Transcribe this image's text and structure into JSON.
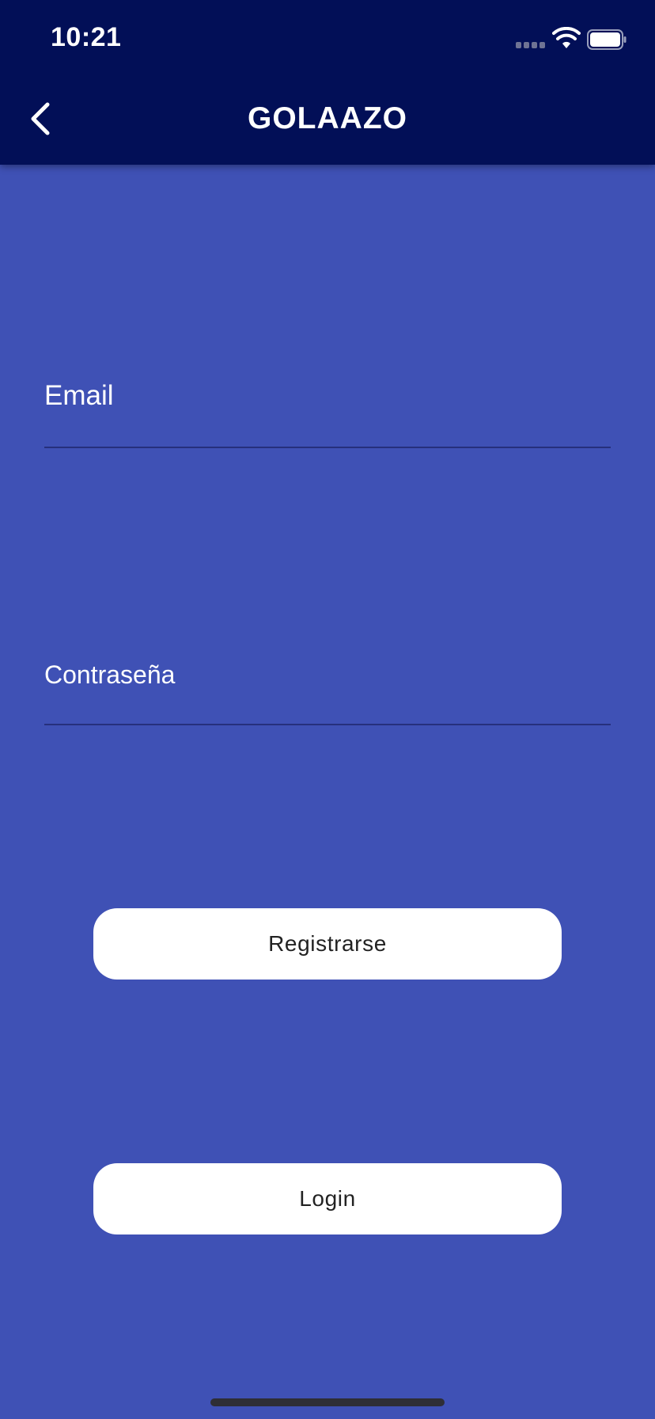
{
  "status_bar": {
    "time": "10:21"
  },
  "header": {
    "title": "GOLAAZO",
    "back_icon": "chevron-left-icon"
  },
  "form": {
    "email_label": "Email",
    "email_value": "",
    "password_label": "Contraseña",
    "password_value": ""
  },
  "buttons": {
    "register_label": "Registrarse",
    "login_label": "Login"
  },
  "colors": {
    "header_background": "#020f57",
    "page_background": "#3f51b5",
    "button_background": "#ffffff",
    "underline": "#26307c"
  }
}
